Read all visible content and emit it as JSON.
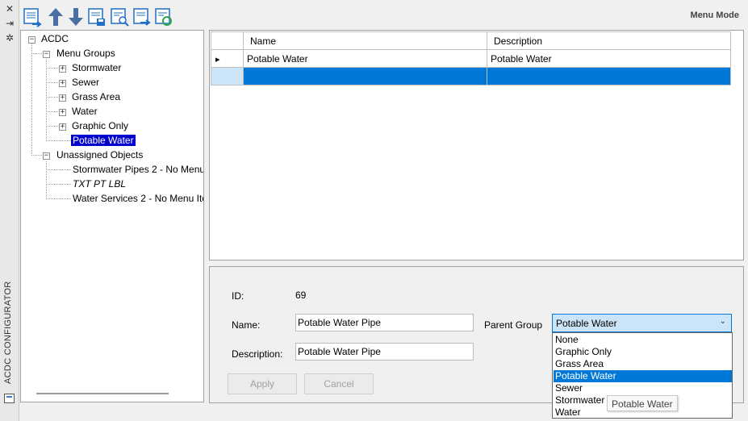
{
  "palette": {
    "selection_blue": "#0078d7",
    "tree_selection": "#0000cc",
    "panel_bg": "#f0f0f0",
    "icon_blue": "#1f6fc5",
    "icon_green": "#2aa84a"
  },
  "side_strip": {
    "close_icon": "✕",
    "pin_icon": "⇥",
    "settings_icon": "✲",
    "title": "ACDC CONFIGURATOR"
  },
  "toolbar": {
    "icons": [
      "list-add-icon",
      "arrow-up-icon",
      "arrow-down-icon",
      "save-list-icon",
      "search-list-icon",
      "export-list-icon",
      "refresh-list-icon"
    ]
  },
  "mode_label": "Menu Mode",
  "tree": {
    "root": "ACDC",
    "menu_groups_label": "Menu Groups",
    "menu_groups": [
      "Stormwater",
      "Sewer",
      "Grass Area",
      "Water",
      "Graphic Only"
    ],
    "selected_item": "Potable Water",
    "unassigned_label": "Unassigned Objects",
    "unassigned": [
      "Stormwater Pipes 2  - No Menu",
      "TXT PT LBL",
      "Water Services 2 - No Menu Ite"
    ]
  },
  "grid": {
    "columns": [
      "Name",
      "Description"
    ],
    "rows": [
      {
        "name": "Potable Water",
        "description": "Potable Water"
      }
    ],
    "row_indicator": "▸"
  },
  "form": {
    "id_label": "ID:",
    "id_value": "69",
    "name_label": "Name:",
    "name_value": "Potable Water Pipe",
    "description_label": "Description:",
    "description_value": "Potable Water Pipe",
    "parent_group_label": "Parent Group",
    "parent_group_value": "Potable Water",
    "apply_label": "Apply",
    "cancel_label": "Cancel",
    "dropdown_arrow": "⌄"
  },
  "dropdown": {
    "options": [
      "None",
      "Graphic Only",
      "Grass Area",
      "Potable Water",
      "Sewer",
      "Stormwater",
      "Water"
    ],
    "selected": "Potable Water"
  },
  "tooltip": "Potable Water"
}
